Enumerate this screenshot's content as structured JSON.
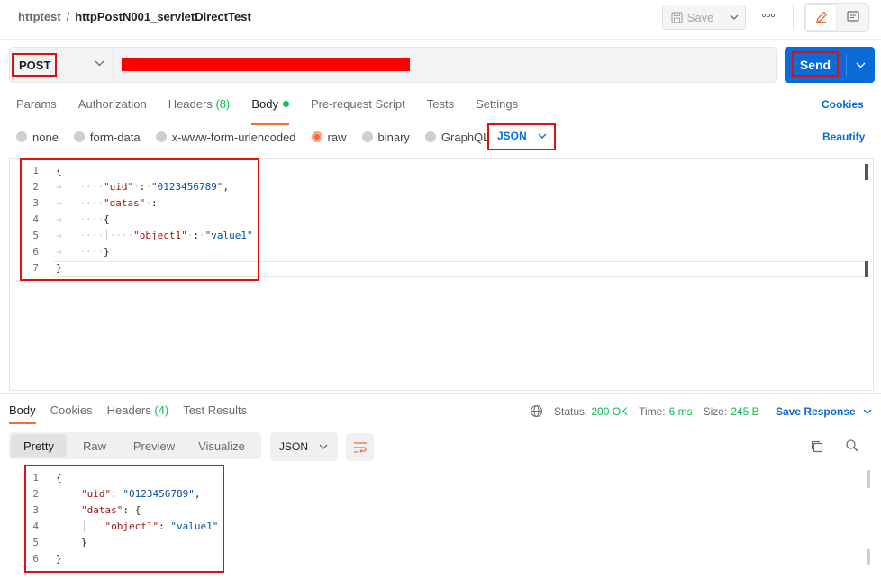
{
  "header": {
    "collection": "httptest",
    "separator": "/",
    "request_name": "httpPostN001_servletDirectTest",
    "save_label": "Save"
  },
  "url_bar": {
    "method": "POST"
  },
  "send": {
    "label": "Send"
  },
  "request_tabs": [
    {
      "label": "Params"
    },
    {
      "label": "Authorization"
    },
    {
      "label": "Headers",
      "count": "(8)"
    },
    {
      "label": "Body"
    },
    {
      "label": "Pre-request Script"
    },
    {
      "label": "Tests"
    },
    {
      "label": "Settings"
    }
  ],
  "cookies_link": "Cookies",
  "body_types": [
    "none",
    "form-data",
    "x-www-form-urlencoded",
    "raw",
    "binary",
    "GraphQL"
  ],
  "body_type_selected": "raw",
  "body_format": "JSON",
  "beautify_label": "Beautify",
  "request_body": {
    "line_numbers": [
      "1",
      "2",
      "3",
      "4",
      "5",
      "6",
      "7"
    ],
    "open_brace": "{",
    "uid_key": "\"uid\"",
    "uid_value": "\"0123456789\"",
    "datas_key": "\"datas\"",
    "inner_open": "{",
    "object1_key": "\"object1\"",
    "object1_value": "\"value1\"",
    "inner_close": "}",
    "close_brace": "}"
  },
  "response_tabs": [
    {
      "label": "Body"
    },
    {
      "label": "Cookies"
    },
    {
      "label": "Headers",
      "count": "(4)"
    },
    {
      "label": "Test Results"
    }
  ],
  "response_status": {
    "status_label": "Status:",
    "status_value": "200 OK",
    "time_label": "Time:",
    "time_value": "6 ms",
    "size_label": "Size:",
    "size_value": "245 B"
  },
  "save_response_label": "Save Response",
  "view_modes": [
    "Pretty",
    "Raw",
    "Preview",
    "Visualize"
  ],
  "view_mode_selected": "Pretty",
  "response_format": "JSON",
  "response_body": {
    "line_numbers": [
      "1",
      "2",
      "3",
      "4",
      "5",
      "6"
    ],
    "open_brace": "{",
    "uid_key": "\"uid\"",
    "uid_value": "\"0123456789\"",
    "datas_key": "\"datas\"",
    "object1_key": "\"object1\"",
    "object1_value": "\"value1\"",
    "inner_close": "}",
    "close_brace": "}"
  },
  "colors": {
    "accent_blue": "#0a6ad8",
    "success_green": "#0cbb52",
    "active_orange": "#f26b3a",
    "annotation_red": "#e01010",
    "json_key": "#a31515",
    "json_string": "#0451a5"
  },
  "icons": [
    "save-icon",
    "chevron-down-icon",
    "more-icon",
    "edit-icon",
    "comment-icon",
    "globe-icon",
    "wrap-lines-icon",
    "copy-icon",
    "search-icon"
  ]
}
